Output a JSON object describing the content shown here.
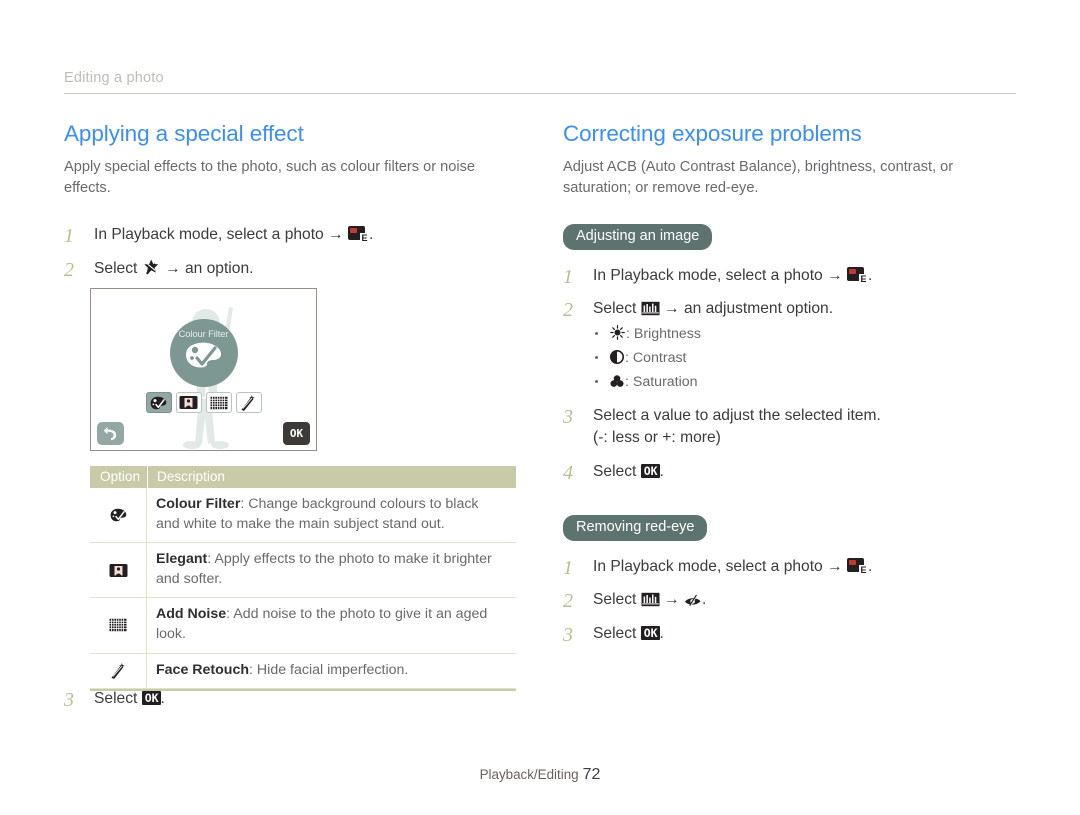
{
  "breadcrumb": "Editing a photo",
  "colors": {
    "heading_blue": "#3b8ef2",
    "pill_slate": "#5d7370",
    "table_header_khaki": "#c9cba8",
    "step_number_sage": "#b5bf93",
    "cam_disc": "#7d9893"
  },
  "left": {
    "title": "Applying a special effect",
    "lede": "Apply special effects to the photo, such as colour filters or noise effects.",
    "steps": [
      {
        "num": "1",
        "pre": "In Playback mode, select a photo ",
        "arrow": "→",
        "icon": "photo-edit-icon",
        "post": "."
      },
      {
        "num": "2",
        "pre": "Select ",
        "icon": "star-pen-icon",
        "arrow": "→",
        "post": " an option."
      },
      {
        "num": "3",
        "pre": "Select ",
        "ok": "OK",
        "post": "."
      }
    ],
    "camera_screen": {
      "disc_label": "Colour Filter",
      "disc_icon": "palette-check-icon",
      "options": [
        {
          "icon": "palette-icon",
          "selected": true
        },
        {
          "icon": "elegant-portrait-icon",
          "selected": false
        },
        {
          "icon": "add-noise-grid-icon",
          "selected": false
        },
        {
          "icon": "face-retouch-wand-icon",
          "selected": false
        }
      ],
      "back_label": "back-arrow-icon",
      "ok_label": "OK"
    },
    "table": {
      "headers": [
        "Option",
        "Description"
      ],
      "rows": [
        {
          "icon": "palette-icon",
          "term": "Colour Filter",
          "desc": ": Change background colours to black and white to make the main subject stand out."
        },
        {
          "icon": "elegant-portrait-icon",
          "term": "Elegant",
          "desc": ": Apply effects to the photo to make it brighter and softer."
        },
        {
          "icon": "add-noise-grid-icon",
          "term": "Add Noise",
          "desc": ": Add noise to the photo to give it an aged look."
        },
        {
          "icon": "face-retouch-wand-icon",
          "term": "Face Retouch",
          "desc": ": Hide facial imperfection."
        }
      ]
    }
  },
  "right": {
    "title": "Correcting exposure problems",
    "lede": "Adjust ACB (Auto Contrast Balance), brightness, contrast, or saturation; or remove red-eye.",
    "section1": {
      "pill": "Adjusting an image",
      "steps": [
        {
          "num": "1",
          "pre": "In Playback mode, select a photo ",
          "arrow": "→",
          "icon": "photo-edit-icon",
          "post": "."
        },
        {
          "num": "2",
          "pre": "Select ",
          "icon": "adjust-histogram-icon",
          "arrow": "→",
          "post": " an adjustment option."
        },
        {
          "num": "3",
          "pre": "Select a value to adjust the selected item.",
          "sub": "(-: less or +: more)"
        },
        {
          "num": "4",
          "pre": "Select ",
          "ok": "OK",
          "post": "."
        }
      ],
      "bullets": [
        {
          "icon": "brightness-sun-icon",
          "label": ": Brightness"
        },
        {
          "icon": "contrast-half-circle-icon",
          "label": ": Contrast"
        },
        {
          "icon": "saturation-circles-icon",
          "label": ": Saturation"
        }
      ]
    },
    "section2": {
      "pill": "Removing red-eye",
      "steps": [
        {
          "num": "1",
          "pre": "In Playback mode, select a photo ",
          "arrow": "→",
          "icon": "photo-edit-icon",
          "post": "."
        },
        {
          "num": "2",
          "pre": "Select ",
          "icon": "adjust-histogram-icon",
          "arrow": "→",
          "icon2": "red-eye-icon",
          "post": "."
        },
        {
          "num": "3",
          "pre": "Select ",
          "ok": "OK",
          "post": "."
        }
      ]
    }
  },
  "footer": {
    "label": "Playback/Editing",
    "page": "72"
  }
}
